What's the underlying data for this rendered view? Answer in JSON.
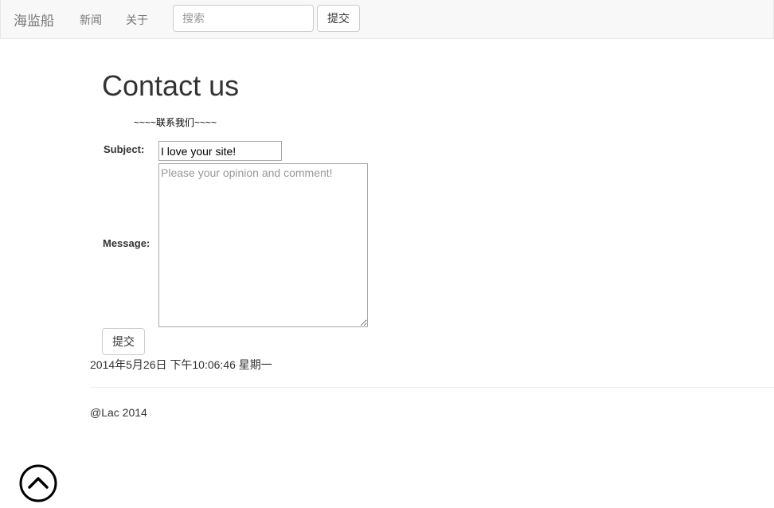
{
  "navbar": {
    "brand": "海监船",
    "links": [
      {
        "label": "新闻"
      },
      {
        "label": "关于"
      }
    ],
    "search": {
      "value": "",
      "placeholder": "搜索"
    },
    "submit_label": "提交"
  },
  "main": {
    "title": "Contact us",
    "subtitle": "~~~~联系我们~~~~",
    "form": {
      "subject_label": "Subject:",
      "subject_value": "I love your site!",
      "message_label": "Message:",
      "message_value": "",
      "message_placeholder": "Please your opinion and comment!",
      "submit_label": "提交"
    },
    "datetime": "2014年5月26日 下午10:06:46 星期一"
  },
  "footer": {
    "text": "@Lac 2014"
  },
  "icons": {
    "back_to_top": "chevron-up-circle-icon"
  }
}
